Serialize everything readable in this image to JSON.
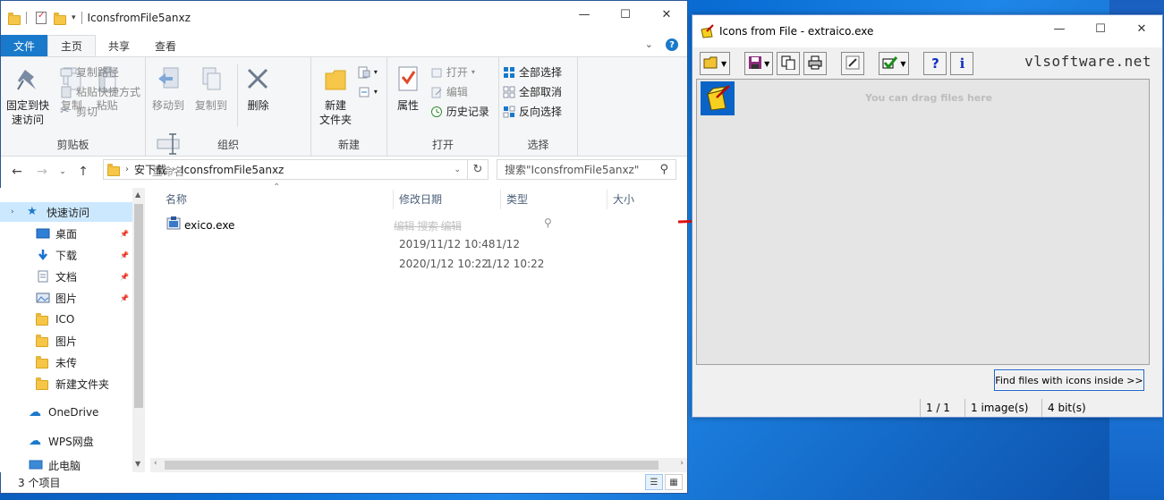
{
  "explorer": {
    "title": "IconsfromFile5anxz",
    "window_controls": {
      "minimize": "—",
      "maximize": "☐",
      "close": "✕"
    },
    "ribbon_tabs": [
      "文件",
      "主页",
      "共享",
      "查看"
    ],
    "ribbon": {
      "clipboard": {
        "pin_quick_access": "固定到快\n速访问",
        "copy": "复制",
        "paste": "粘贴",
        "copy_path": "复制路径",
        "paste_shortcut": "粘贴快捷方式",
        "cut": "剪切",
        "group_label": "剪贴板"
      },
      "organize": {
        "move_to": "移动到",
        "copy_to": "复制到",
        "delete": "删除",
        "rename": "重命名",
        "group_label": "组织"
      },
      "new": {
        "new_folder": "新建\n文件夹",
        "group_label": "新建"
      },
      "open": {
        "properties": "属性",
        "open": "打开",
        "edit": "编辑",
        "history": "历史记录",
        "group_label": "打开"
      },
      "select": {
        "select_all": "全部选择",
        "select_none": "全部取消",
        "invert_selection": "反向选择",
        "group_label": "选择"
      }
    },
    "address": {
      "crumbs": [
        "安下载",
        "IconsfromFile5anxz"
      ],
      "search_placeholder": "搜索\"IconsfromFile5anxz\""
    },
    "nav": {
      "quick_access": "快速访问",
      "items": [
        {
          "label": "桌面",
          "pinned": true
        },
        {
          "label": "下载",
          "pinned": true
        },
        {
          "label": "文档",
          "pinned": true
        },
        {
          "label": "图片",
          "pinned": true
        },
        {
          "label": "ICO",
          "pinned": false
        },
        {
          "label": "图片",
          "pinned": false
        },
        {
          "label": "未传",
          "pinned": false
        },
        {
          "label": "新建文件夹",
          "pinned": false
        }
      ],
      "onedrive": "OneDrive",
      "wps": "WPS网盘",
      "this_pc": "此电脑"
    },
    "columns": {
      "name": "名称",
      "modified": "修改日期",
      "type": "类型",
      "size": "大小"
    },
    "files": [
      {
        "name": "exico.exe"
      }
    ],
    "ghost_dates": [
      "2019/11/12 10:48",
      "1/12",
      "2020/1/12 10:22",
      "1/12 10:22"
    ],
    "status": "3 个项目"
  },
  "iff": {
    "title": "Icons from File - extraico.exe",
    "window_controls": {
      "minimize": "—",
      "maximize": "☐",
      "close": "✕"
    },
    "brand": "vlsoftware.net",
    "drag_hint": "You can drag files here",
    "find_button": "Find files with icons inside >>",
    "status": {
      "index": "1 / 1",
      "images": "1 image(s)",
      "depth": "4 bit(s)"
    }
  },
  "colors": {
    "accent": "#1979ca",
    "selection": "#cce8ff",
    "arrow": "#e01010"
  }
}
